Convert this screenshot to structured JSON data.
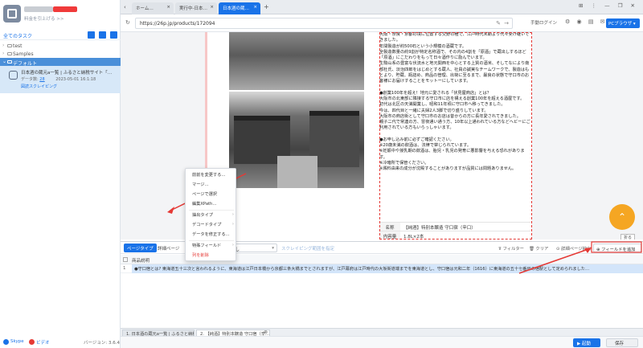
{
  "sidebar": {
    "user_sub": "料金を引上げる >>",
    "tasks_title": "全てのタスク",
    "tree": [
      {
        "label": "test"
      },
      {
        "label": "Samples"
      },
      {
        "label": "デフォルト"
      }
    ],
    "task": {
      "title": "日本酒の蔵元a一覧 | ふるさと納税サイト「…",
      "meta1_label": "データ数:",
      "meta1_value": "28",
      "meta1_date": "2023-05-01 16:1:18",
      "meta2": "図読スクレイピング"
    },
    "footer": {
      "skype": "Skype",
      "video": "ビデオ",
      "version": "バージョン: 3.6.4"
    }
  },
  "browser": {
    "tabs": [
      {
        "label": "ホーム…"
      },
      {
        "label": "実行中-日本…"
      },
      {
        "label": "日本酒の蔵…"
      }
    ],
    "new_tab": "+",
    "url": "https://26p.jp/products/172094",
    "login": "手動ログイン",
    "pc_browser": "PCブラウザ",
    "window_controls": "⊞ ⋮ — ❐ ✕"
  },
  "web": {
    "paragraphs": [
      "大阪・奈良・京都の境に位置する交野の種で、江戸時代末期より代々受け継いできました。",
      "年間製造が約500石という小規模の酒蔵です。",
      "全製造数量の約9割が特定名称酒で、その内の4割を「原酒」で蔵出しするほど「原酒」にこだわりをもって日々酒作りに励んでいます。",
      "生駒山系の豊富な伏流水と地元関西を中心とする上質の酒米、そしてなにより南部杜氏、淡治四郎をはじめとする蔵人、社員の誠実なチームワークで、製造はもとより、貯蔵、瓶詰め、商品の管理、出荷に至るまで、最良の状態で守口市のお客様にお届けすることをモットーにしています。",
      "●創業100年を超え！地元に愛される「伏見屋商店」とは？",
      "大阪市の北東部に隣接する守口市に店を構える創業100年を超える酒屋です。",
      "初代は北区の天満開業し、昭和11年頃に守口市へ移ってきました。",
      "今は、四代目と一緒に夫婦2人3脚で切り盛りしています。",
      "大阪市の商店街として守口市のお店は昔からの方に長年愛されてきました。",
      "親子二代で常連の方、冒夜通い通う方、10年以上通われている方などヘビーにご利用されている方もいらっしゃいます。",
      "●お申し込み前に必ずご確認ください。",
      "※20歳未満の飲酒は、法律で禁じられています。",
      "※妊娠中や授乳期の飲酒は、胎児・乳児の発育に悪影響を与える恐れがあります。",
      "※冷暗所で保管ください。",
      "※澱料由来の成分が沈殿することがありますが品質には問題ありません。"
    ],
    "table": [
      {
        "key": "名称",
        "value": "【純酒】特別本醸造 守口宿（辛口）"
      },
      {
        "key": "内容量",
        "value": "1.8L×2本"
      }
    ],
    "fab_label": "折る"
  },
  "context_menu": {
    "items": [
      {
        "label": "前前を変更する…",
        "submenu": false,
        "danger": false
      },
      {
        "label": "マージ…",
        "submenu": false,
        "danger": false
      },
      {
        "label": "ページで選択",
        "submenu": false,
        "danger": false
      },
      {
        "label": "編集XPath…",
        "submenu": false,
        "danger": false
      },
      {
        "label": "抽出タイプ",
        "submenu": true,
        "danger": false
      },
      {
        "label": "デコードタイプ",
        "submenu": true,
        "danger": false
      },
      {
        "label": "データを修正する…",
        "submenu": false,
        "danger": false
      },
      {
        "label": "特殊フィールド",
        "submenu": true,
        "danger": false
      },
      {
        "label": "列を削除",
        "submenu": false,
        "danger": true
      }
    ]
  },
  "panel": {
    "tab_page_type": "ページタイプ",
    "tab_detail": "詳細ページ",
    "select_value": "必要なし",
    "scroll_link": "スクレイピング範囲を指定",
    "tools": {
      "filter": "フィルター",
      "clear": "クリア",
      "detail_page": "詳細ページ抽出",
      "add_field": "フィールドを追加"
    },
    "column_header": "商品説明",
    "row_number": "1",
    "row_value": "●守口宿とは? 東海道五十三次と言われるように、東海道は江戸日本橋から京都三条大橋までとされますが、江戸幕府は江戸時代の大坂街道端までを東海道とし、守口宿は元和二年（1616）に東海道の五十七番目の宿駅として定められました…"
  },
  "bottom_tabs": [
    {
      "label": "1. 日本酒の蔵元a一覧 | ふるさと納税サ…"
    },
    {
      "label": "2. 【純酒】特別本醸造 守口宿（辛…"
    }
  ],
  "bottom_bar": {
    "run": "起動",
    "save": "保存"
  },
  "colors": {
    "accent": "#1a73e8",
    "selection": "#d3e5fa",
    "annotation": "#e53935",
    "fab": "#f5a623"
  }
}
